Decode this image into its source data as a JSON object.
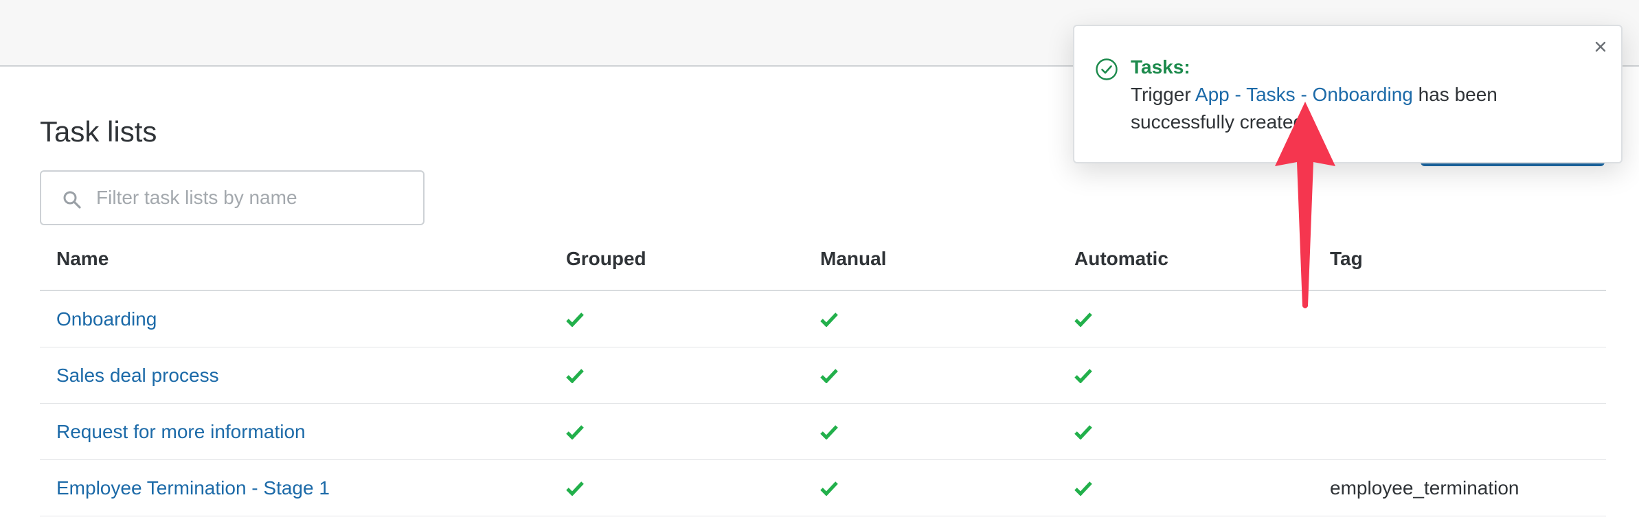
{
  "page": {
    "title": "Task lists"
  },
  "search": {
    "placeholder": "Filter task lists by name",
    "value": "",
    "icon": "search-icon"
  },
  "table": {
    "headers": {
      "name": "Name",
      "grouped": "Grouped",
      "manual": "Manual",
      "automatic": "Automatic",
      "tag": "Tag"
    },
    "rows": [
      {
        "name": "Onboarding",
        "grouped": true,
        "manual": true,
        "automatic": true,
        "tag": ""
      },
      {
        "name": "Sales deal process",
        "grouped": true,
        "manual": true,
        "automatic": true,
        "tag": ""
      },
      {
        "name": "Request for more information",
        "grouped": true,
        "manual": true,
        "automatic": true,
        "tag": ""
      },
      {
        "name": "Employee Termination - Stage 1",
        "grouped": true,
        "manual": true,
        "automatic": true,
        "tag": "employee_termination"
      }
    ]
  },
  "toast": {
    "title": "Tasks:",
    "message_prefix": "Trigger ",
    "message_link": "App - Tasks - Onboarding",
    "message_suffix": " has been successfully created",
    "icon": "check-circle-icon",
    "close_icon": "close-icon"
  },
  "colors": {
    "link": "#1c6aa8",
    "check": "#22b04b",
    "success_title": "#1c8a4c",
    "annotation_arrow": "#f5364f"
  }
}
